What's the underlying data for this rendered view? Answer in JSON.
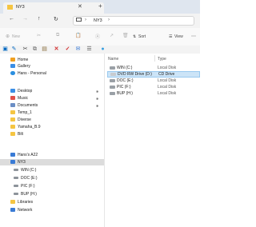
{
  "window": {
    "tab_title": "NY3",
    "close_glyph": "✕",
    "new_tab_glyph": "+"
  },
  "address": {
    "path_segment": "NY3",
    "chevron": "›",
    "chevron_end": "›"
  },
  "navigation": {
    "back": "←",
    "forward": "→",
    "up": "↑",
    "refresh": "↻"
  },
  "ribbon": {
    "new_label": "New",
    "sort_label": "Sort",
    "view_label": "View"
  },
  "nav_pane": {
    "quick": [
      {
        "label": "Home",
        "icon": "home-icon"
      },
      {
        "label": "Gallery",
        "icon": "gallery-icon"
      },
      {
        "label": "Hans - Personal",
        "icon": "cloud-icon"
      }
    ],
    "pinned": [
      {
        "label": "Desktop",
        "icon": "desktop-icon",
        "pinned": true
      },
      {
        "label": "Music",
        "icon": "music-icon",
        "pinned": true
      },
      {
        "label": "Documents",
        "icon": "documents-icon",
        "pinned": true
      },
      {
        "label": "Temp_1",
        "icon": "folder-icon"
      },
      {
        "label": "Diverse",
        "icon": "folder-icon"
      },
      {
        "label": "Yamaha_B.9",
        "icon": "folder-icon"
      },
      {
        "label": "Bilt",
        "icon": "folder-icon"
      }
    ],
    "tree": [
      {
        "label": "Hans's A22",
        "icon": "pc-icon"
      },
      {
        "label": "NY3",
        "icon": "pc-icon",
        "selected": true
      },
      {
        "label": "WIN (C:)",
        "icon": "drive-icon"
      },
      {
        "label": "DOC (E:)",
        "icon": "drive-icon"
      },
      {
        "label": "PIC (F:)",
        "icon": "drive-icon"
      },
      {
        "label": "BUP (H:)",
        "icon": "drive-icon"
      },
      {
        "label": "Libraries",
        "icon": "libraries-icon"
      },
      {
        "label": "Network",
        "icon": "network-icon"
      }
    ]
  },
  "content": {
    "columns": {
      "name": "Name",
      "type": "Type"
    },
    "rows": [
      {
        "name": "WIN (C:)",
        "type": "Local Disk"
      },
      {
        "name": "DVD RW Drive (D:)",
        "type": "CD Drive",
        "selected": true
      },
      {
        "name": "DOC (E:)",
        "type": "Local Disk"
      },
      {
        "name": "PIC (F:)",
        "type": "Local Disk"
      },
      {
        "name": "BUP (H:)",
        "type": "Local Disk"
      }
    ]
  },
  "colors": {
    "accent": "#0067c0",
    "selection": "#cce4f7",
    "folder": "#f5c542"
  }
}
